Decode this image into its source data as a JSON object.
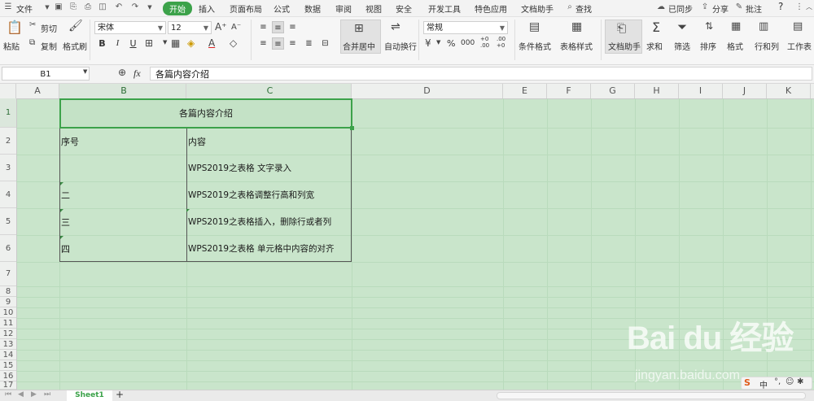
{
  "menu": {
    "file_label": "文件",
    "tabs": [
      "开始",
      "插入",
      "页面布局",
      "公式",
      "数据",
      "审阅",
      "视图",
      "安全",
      "开发工具",
      "特色应用",
      "文档助手"
    ],
    "active_tab": "开始",
    "search_label": "查找",
    "sync_label": "已同步",
    "share_label": "分享",
    "comment_label": "批注",
    "help_label": "?"
  },
  "ribbon": {
    "paste_label": "粘贴",
    "cut_label": "剪切",
    "copy_label": "复制",
    "format_painter_label": "格式刷",
    "font_name": "宋体",
    "font_size": "12",
    "bold": "B",
    "italic": "I",
    "underline": "U",
    "merge_label": "合并居中",
    "wrap_label": "自动换行",
    "number_format": "常规",
    "percent": "%",
    "thousand": "000",
    "inc_decimal": "+0 .00",
    "dec_decimal": ".00 +0",
    "cond_format_label": "条件格式",
    "table_style_label": "表格样式",
    "doc_assistant_label": "文档助手",
    "sum_label": "求和",
    "filter_label": "筛选",
    "sort_label": "排序",
    "format_label": "格式",
    "rowcol_label": "行和列",
    "sheet_label": "工作表"
  },
  "formula_bar": {
    "cell_ref": "B1",
    "fx": "fx",
    "content": "各篇内容介绍"
  },
  "columns": [
    "A",
    "B",
    "C",
    "D",
    "E",
    "F",
    "G",
    "H",
    "I",
    "J",
    "K"
  ],
  "rows": [
    "1",
    "2",
    "3",
    "4",
    "5",
    "6",
    "7",
    "8",
    "9",
    "10",
    "11",
    "12",
    "13",
    "14",
    "15",
    "16",
    "17"
  ],
  "table": {
    "title": "各篇内容介绍",
    "header": {
      "col_b": "序号",
      "col_c": "内容"
    },
    "rows": [
      {
        "col_b": "",
        "col_c": "WPS2019之表格 文字录入"
      },
      {
        "col_b": "二",
        "col_c": "WPS2019之表格调整行高和列宽"
      },
      {
        "col_b": "三",
        "col_c": "WPS2019之表格插入，删除行或者列"
      },
      {
        "col_b": "四",
        "col_c": "WPS2019之表格  单元格中内容的对齐"
      }
    ]
  },
  "sheet_tab": "Sheet1",
  "add_sheet": "+",
  "watermark": {
    "brand": "Bai du 经验",
    "url": "jingyan.baidu.com"
  },
  "ime": {
    "label": "中"
  },
  "colors": {
    "accent": "#3ca24a",
    "sheet_bg": "#c9e5cb",
    "gridline": "#b9dbbc",
    "selected_border": "#3ca24a"
  }
}
